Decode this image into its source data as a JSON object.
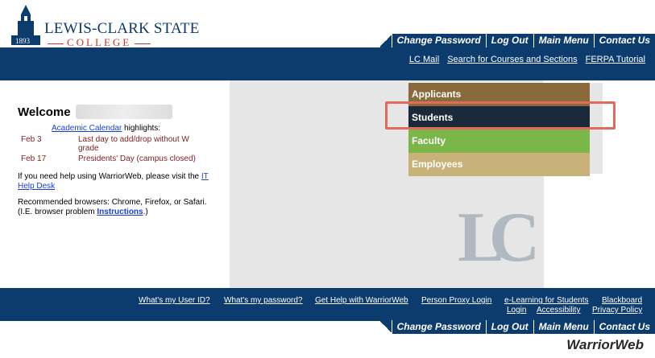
{
  "header": {
    "school_name": "LEWIS-CLARK STATE",
    "college": "COLLEGE",
    "year": "1893",
    "top_nav": [
      "Change Password",
      "Log Out",
      "Main Menu",
      "Contact Us"
    ],
    "sub_links": [
      "LC Mail",
      "Search for Courses and Sections",
      "FERPA Tutorial"
    ]
  },
  "menu": {
    "items": [
      "Applicants",
      "Students",
      "Faculty",
      "Employees"
    ]
  },
  "left": {
    "welcome": "Welcome",
    "calendar_link": "Academic Calendar",
    "calendar_suffix": " highlights:",
    "events": [
      {
        "date": "Feb 3",
        "text": "Last day to add/drop without W grade"
      },
      {
        "date": "Feb 17",
        "text": "Presidents' Day (campus closed)"
      }
    ],
    "help_text": "If you need help using WarriorWeb, please visit the ",
    "help_link": "IT Help Desk",
    "browsers_text": "Recommended browsers: Chrome, Firefox, or Safari. (I.E. browser problem ",
    "browsers_link": "Instructions",
    "browsers_suffix": ".)"
  },
  "watermark": {
    "letters": "LC"
  },
  "footer": {
    "links": [
      "What's my User ID?",
      "What's my password?",
      "Get Help with WarriorWeb",
      "Person Proxy Login",
      "e-Learning for Students",
      "Blackboard",
      "Login",
      "Accessibility",
      "Privacy Policy"
    ],
    "bottom_nav": [
      "Change Password",
      "Log Out",
      "Main Menu",
      "Contact Us"
    ],
    "brand": "WarriorWeb"
  }
}
